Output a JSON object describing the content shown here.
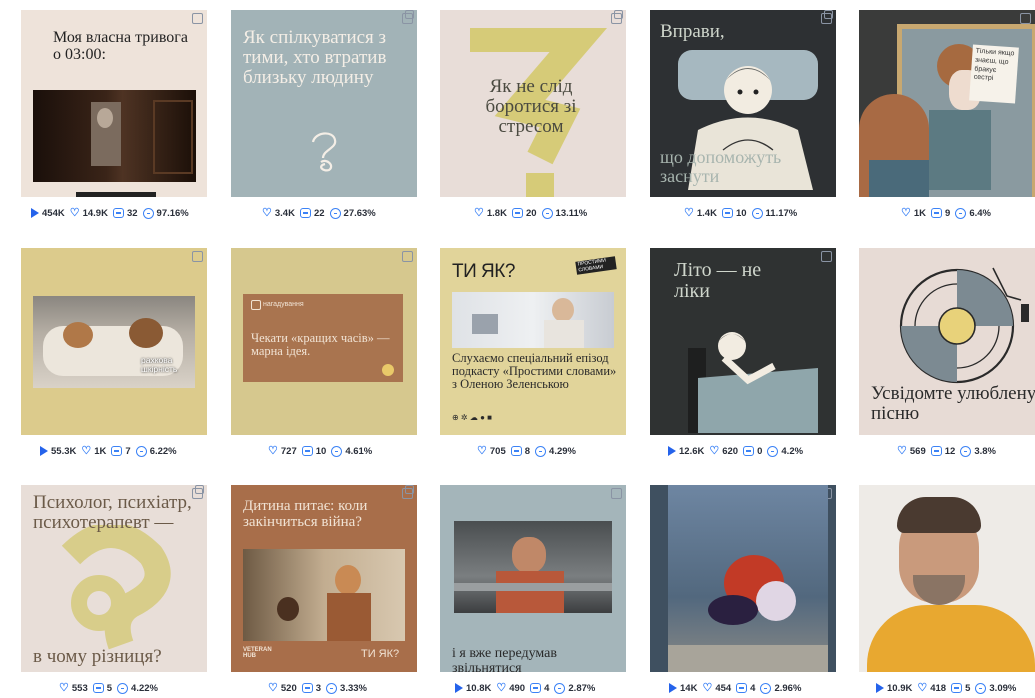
{
  "posts": [
    {
      "caption": "Моя власна тривога о 03:00:",
      "stats": {
        "views": "454K",
        "likes": "14.9K",
        "comments": "32",
        "er": "97.16%"
      }
    },
    {
      "caption": "Як спілкуватися з тими, хто втратив близьку людину",
      "stats": {
        "likes": "3.4K",
        "comments": "22",
        "er": "27.63%"
      }
    },
    {
      "caption": "Як не слід боротися зі стресом",
      "stats": {
        "likes": "1.8K",
        "comments": "20",
        "er": "13.11%"
      }
    },
    {
      "caption_top": "Вправи,",
      "caption_bottom": "що допоможуть заснути",
      "stats": {
        "likes": "1.4K",
        "comments": "10",
        "er": "11.17%"
      }
    },
    {
      "note": "Тільки якщо знаєш, що бракує сестрі",
      "stats": {
        "likes": "1K",
        "comments": "9",
        "er": "6.4%"
      }
    },
    {
      "overlay": "рахкова шкірність",
      "stats": {
        "views": "55.3K",
        "likes": "1K",
        "comments": "7",
        "er": "6.22%"
      }
    },
    {
      "tag": "нагадування",
      "caption": "Чекати «кращих часів» — марна ідея.",
      "stats": {
        "likes": "727",
        "comments": "10",
        "er": "4.61%"
      }
    },
    {
      "brand": "ТИ ЯК?",
      "badge": "ПРОСТИМИ СЛОВАМИ",
      "caption": "Слухаємо спеціальний епізод подкасту «Простими словами» з Оленою Зеленською",
      "stats": {
        "likes": "705",
        "comments": "8",
        "er": "4.29%"
      }
    },
    {
      "caption": "Літо — не ліки",
      "stats": {
        "views": "12.6K",
        "likes": "620",
        "comments": "0",
        "er": "4.2%"
      }
    },
    {
      "caption": "Усвідомте улюблену пісню",
      "stats": {
        "likes": "569",
        "comments": "12",
        "er": "3.8%"
      }
    },
    {
      "caption_top": "Психолог, психіатр, психотерапевт —",
      "caption_bottom": "в чому різниця?",
      "stats": {
        "likes": "553",
        "comments": "5",
        "er": "4.22%"
      }
    },
    {
      "caption": "Дитина питає: коли закінчиться війна?",
      "logo_left": "VETERAN HUB",
      "logo_right": "ТИ ЯК?",
      "stats": {
        "likes": "520",
        "comments": "3",
        "er": "3.33%"
      }
    },
    {
      "caption": "і я вже передумав звільнятися",
      "stats": {
        "views": "10.8K",
        "likes": "490",
        "comments": "4",
        "er": "2.87%"
      }
    },
    {
      "stats": {
        "views": "14K",
        "likes": "454",
        "comments": "4",
        "er": "2.96%"
      }
    },
    {
      "stats": {
        "views": "10.9K",
        "likes": "418",
        "comments": "5",
        "er": "3.09%"
      }
    }
  ]
}
